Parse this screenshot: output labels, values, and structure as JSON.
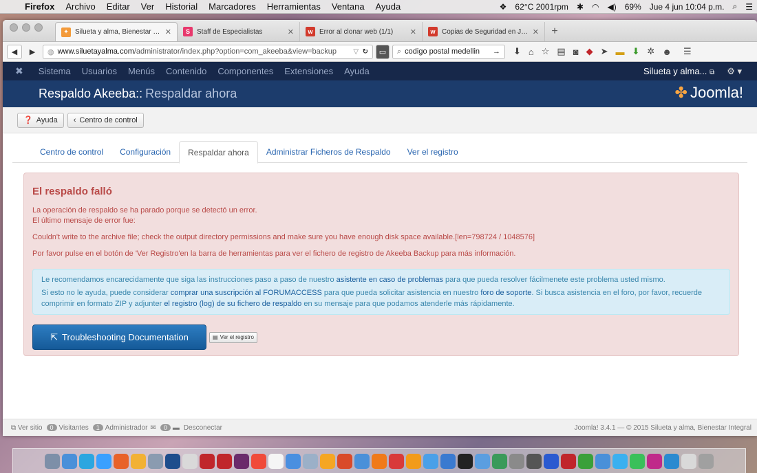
{
  "menubar": {
    "app": "Firefox",
    "items": [
      "Archivo",
      "Editar",
      "Ver",
      "Historial",
      "Marcadores",
      "Herramientas",
      "Ventana",
      "Ayuda"
    ],
    "temp": "62°C 2001rpm",
    "battery": "69%",
    "datetime": "Jue 4 jun  10:04 p.m."
  },
  "tabs": [
    {
      "title": "Silueta y alma, Bienestar Int...",
      "fav_color": "#f39a3a"
    },
    {
      "title": "Staff de Especialistas",
      "fav_color": "#e8386c"
    },
    {
      "title": "Error al clonar web (1/1)",
      "fav_color": "#d23a2c"
    },
    {
      "title": "Copias de Seguridad en Jo...",
      "fav_color": "#d23a2c"
    }
  ],
  "url": {
    "host": "www.siluetayalma.com",
    "path": "/administrator/index.php?option=com_akeeba&view=backup"
  },
  "search": {
    "value": "codigo postal medellin"
  },
  "jnav": {
    "items": [
      "Sistema",
      "Usuarios",
      "Menús",
      "Contenido",
      "Componentes",
      "Extensiones",
      "Ayuda"
    ],
    "user": "Silueta y alma..."
  },
  "title": {
    "main": "Respaldo Akeeba::",
    "sub": "Respaldar ahora",
    "brand": "Joomla!"
  },
  "toolbar": {
    "help": "Ayuda",
    "control": "Centro de control"
  },
  "subtabs": [
    "Centro de control",
    "Configuración",
    "Respaldar ahora",
    "Administrar Ficheros de Respaldo",
    "Ver el registro"
  ],
  "error": {
    "heading": "El respaldo falló",
    "line1": "La operación de respaldo se ha parado porque se detectó un error.",
    "line2": "El último mensaje de error fue:",
    "message": "Couldn't write to the archive file; check the output directory permissions and make sure you have enough disk space available.[len=798724 / 1048576]",
    "hint": "Por favor pulse en el botón de 'Ver Registro'en la barra de herramientas para ver el fichero de registro de Akeeba Backup para más información."
  },
  "info": {
    "p1_a": "Le recomendamos encarecidamente que siga las instrucciones paso a paso de nuestro ",
    "p1_link": "asistente en caso de problemas",
    "p1_b": " para que pueda resolver fácilmenete este problema usted mismo.",
    "p2_a": "Si esto no le ayuda, puede considerar ",
    "p2_link1": "comprar una suscripción al FORUMACCESS",
    "p2_b": " para que pueda solicitar asistencia en nuestro ",
    "p2_link2": "foro de soporte",
    "p2_c": ". Si busca asistencia en el foro, por favor, recuerde comprimir en formato ZIP y adjunter ",
    "p2_link3": "el registro (log) de su fichero de respaldo",
    "p2_d": " en su mensaje para que podamos atenderle más rápidamente."
  },
  "buttons": {
    "troubleshoot": "Troubleshooting Documentation",
    "viewlog": "Ver el registro"
  },
  "footer": {
    "site": "Ver sitio",
    "visitors_count": "0",
    "visitors": "Visitantes",
    "admin_count": "1",
    "admin": "Administrador",
    "msg_count": "0",
    "logout": "Desconectar",
    "version": "Joomla! 3.4.1  —  © 2015 Silueta y alma, Bienestar Integral"
  },
  "dock_colors": [
    "#7d8fa8",
    "#4a90d9",
    "#2ba6e0",
    "#3aa0ff",
    "#e8622a",
    "#f2b134",
    "#8a9bb0",
    "#1e4d8c",
    "#d9d9d9",
    "#c0262b",
    "#c0262b",
    "#6b2b6b",
    "#f04a3a",
    "#f5f5f5",
    "#4a8fe0",
    "#9bb0c8",
    "#f5a623",
    "#d94a2a",
    "#4a90d9",
    "#f07a1a",
    "#d93a3a",
    "#f29b1a",
    "#4aa0e8",
    "#3a7ad0",
    "#222",
    "#5b9ee0",
    "#3a9a5a",
    "#8a8a8a",
    "#555",
    "#2a5ad0",
    "#c0262b",
    "#3aa03a",
    "#4a90d9",
    "#3ab0f0",
    "#3ac05a",
    "#c02a8a",
    "#2a8ad0",
    "#d9d9d9",
    "#a0a0a0"
  ]
}
